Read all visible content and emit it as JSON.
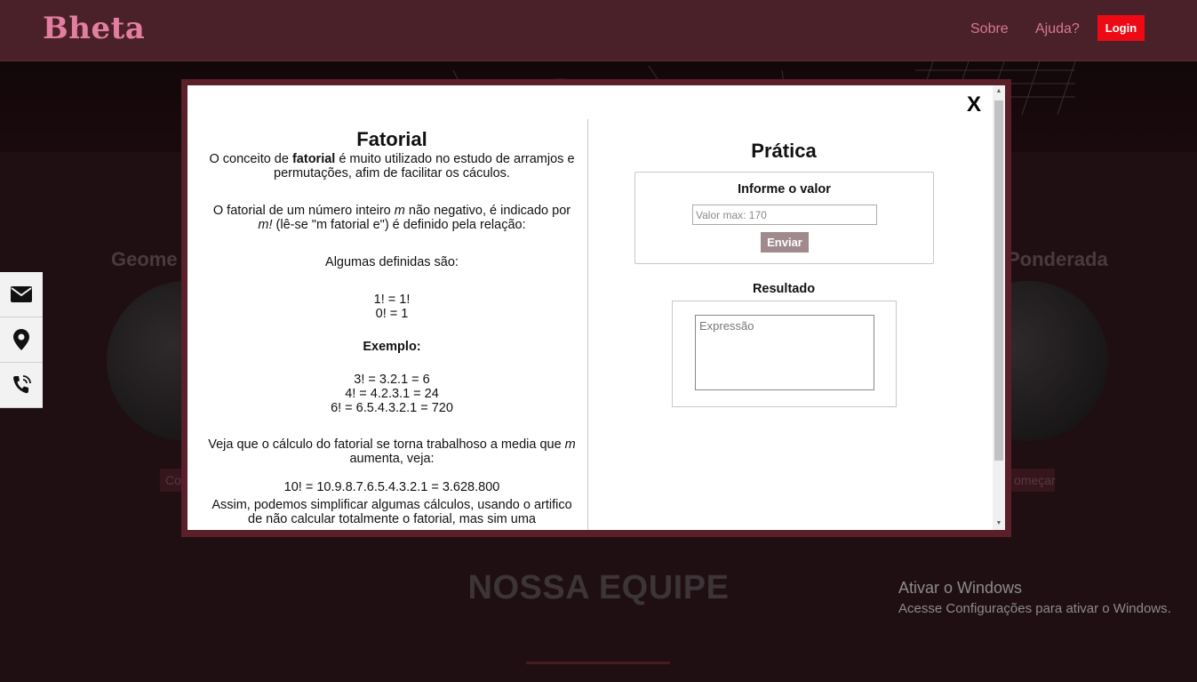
{
  "navbar": {
    "brand": "Bheta",
    "links": [
      "Sobre",
      "Ajuda?"
    ],
    "login_label": "Login"
  },
  "cards": {
    "left_title": "Geome",
    "right_title": "Ponderada",
    "left_button": "Co",
    "right_button": "omeçar"
  },
  "team": {
    "title": "NOSSA EQUIPE"
  },
  "windows_notice": {
    "title": "Ativar o Windows",
    "subtitle": "Acesse Configurações para ativar o Windows."
  },
  "contact_icons": [
    "envelope-icon",
    "map-pin-icon",
    "phone-icon"
  ],
  "modal": {
    "close_label": "X",
    "theory": {
      "title": "Fatorial",
      "intro_pre": "O conceito de ",
      "intro_bold": "fatorial",
      "intro_post": " é muito utilizado no estudo de arramjos e permutações, afim de facilitar os cáculos.",
      "def_1": "O fatorial de um número inteiro ",
      "def_m": "m",
      "def_2": " não negativo, é indicado por ",
      "def_m2": "m!",
      "def_3": " (lê-se \"m fatorial e\") é definido pela relação:",
      "some_defined": "Algumas definidas são:",
      "base_cases": [
        "1! = 1!",
        "0! = 1"
      ],
      "example_title": "Exemplo:",
      "examples": [
        "3! = 3.2.1 = 6",
        "4! = 4.2.3.1 = 24",
        "6! = 6.5.4.3.2.1 = 720"
      ],
      "note_1": "Veja que o cálculo do fatorial se torna trabalhoso a media que ",
      "note_m": "m",
      "note_2": " aumenta, veja:",
      "big_example": "10! = 10.9.8.7.6.5.4.3.2.1 = 3.628.800",
      "simplify": "Assim, podemos simplificar algumas cálculos, usando o artifico de não calcular totalmente o fatorial, mas sim uma"
    },
    "practice": {
      "title": "Prática",
      "input_label": "Informe o valor",
      "input_placeholder": "Valor max: 170",
      "submit_label": "Enviar",
      "result_label": "Resultado",
      "result_placeholder": "Expressão"
    },
    "scroll_arrows": {
      "up": "▲",
      "down": "▼"
    }
  },
  "colors": {
    "navbar_bg": "#4a2129",
    "brand": "#e27fa0",
    "login_bg": "#ee0a14",
    "modal_border": "#5a1f29",
    "submit_bg": "#a08a8e"
  }
}
